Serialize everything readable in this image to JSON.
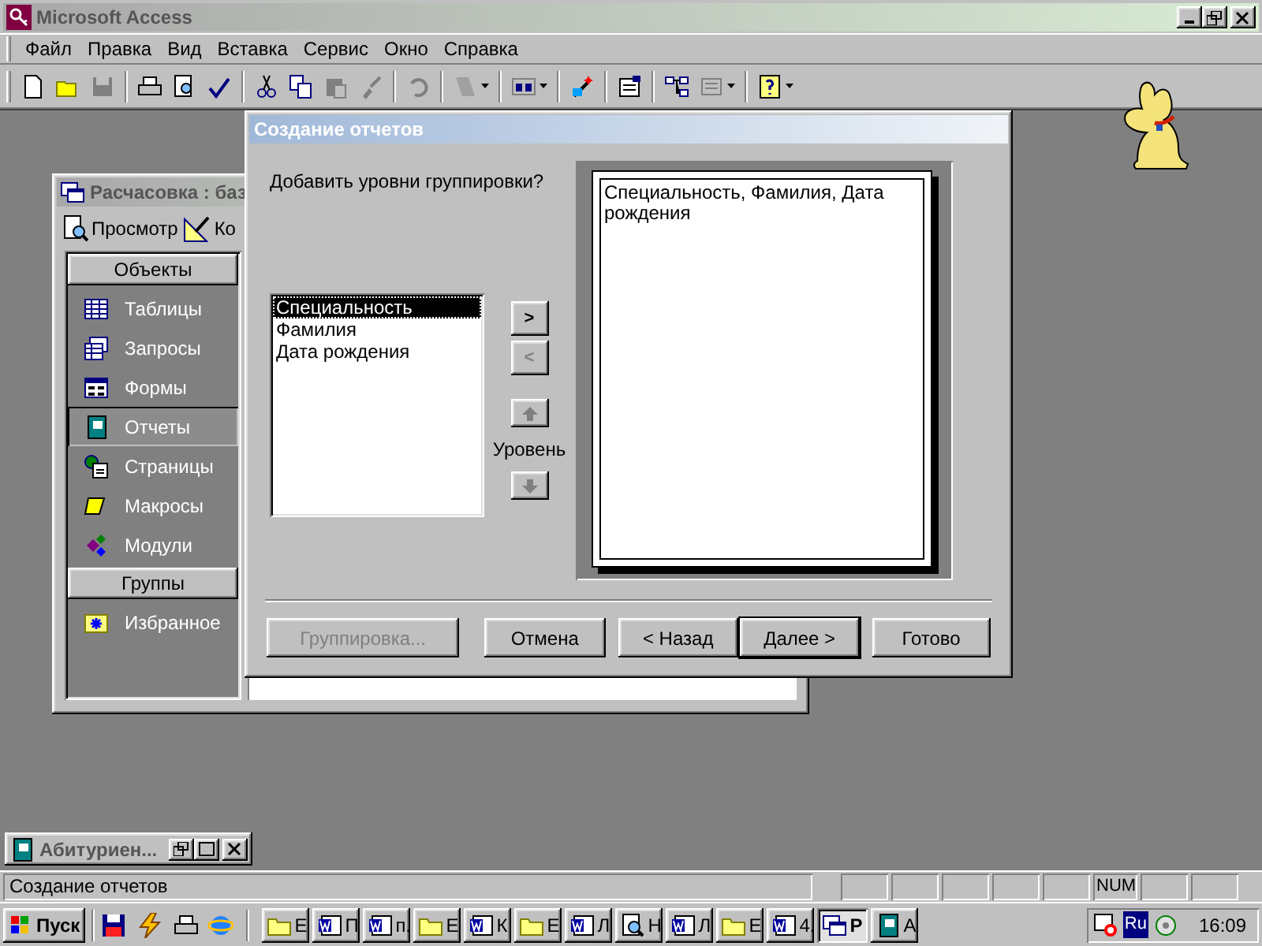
{
  "app_window": {
    "title": "Microsoft Access"
  },
  "menu": [
    {
      "label": "Файл"
    },
    {
      "label": "Правка"
    },
    {
      "label": "Вид"
    },
    {
      "label": "Вставка"
    },
    {
      "label": "Сервис"
    },
    {
      "label": "Окно"
    },
    {
      "label": "Справка"
    }
  ],
  "db_window": {
    "title": "Расчасовка : баз",
    "tools": [
      "Просмотр",
      "Ко"
    ],
    "sections": [
      {
        "header": "Объекты",
        "items": [
          {
            "label": "Таблицы",
            "kind": "table",
            "selected": false
          },
          {
            "label": "Запросы",
            "kind": "query",
            "selected": false
          },
          {
            "label": "Формы",
            "kind": "form",
            "selected": false
          },
          {
            "label": "Отчеты",
            "kind": "report",
            "selected": true
          },
          {
            "label": "Страницы",
            "kind": "page",
            "selected": false
          },
          {
            "label": "Макросы",
            "kind": "macro",
            "selected": false
          },
          {
            "label": "Модули",
            "kind": "module",
            "selected": false
          }
        ]
      },
      {
        "header": "Группы",
        "items": [
          {
            "label": "Избранное",
            "kind": "favorites",
            "selected": false
          }
        ]
      }
    ]
  },
  "wizard": {
    "title": "Создание отчетов",
    "prompt": "Добавить уровни группировки?",
    "fields": [
      {
        "label": "Специальность",
        "selected": true
      },
      {
        "label": "Фамилия",
        "selected": false
      },
      {
        "label": "Дата рождения",
        "selected": false
      }
    ],
    "move_buttons": [
      {
        "label": ">",
        "disabled": false
      },
      {
        "label": "<",
        "disabled": true
      }
    ],
    "level_label": "Уровень",
    "preview_text": "Специальность, Фамилия, Дата рождения",
    "buttons": [
      {
        "label": "Группировка...",
        "disabled": true,
        "default": false
      },
      {
        "label": "Отмена",
        "disabled": false,
        "default": false
      },
      {
        "label": "< Назад",
        "disabled": false,
        "default": false
      },
      {
        "label": "Далее >",
        "disabled": false,
        "default": true
      },
      {
        "label": "Готово",
        "disabled": false,
        "default": false
      }
    ]
  },
  "minimized_window": {
    "title": "Абитуриен..."
  },
  "status_bar": {
    "text": "Создание отчетов",
    "indicators": [
      {
        "label": "NUM"
      }
    ]
  },
  "taskbar": {
    "start": "Пуск",
    "buttons": [
      {
        "kind": "folder",
        "label": "Е",
        "selected": false
      },
      {
        "kind": "word",
        "label": "П",
        "selected": false
      },
      {
        "kind": "word",
        "label": "п.",
        "selected": false
      },
      {
        "kind": "folder",
        "label": "Е",
        "selected": false
      },
      {
        "kind": "word",
        "label": "К",
        "selected": false
      },
      {
        "kind": "folder",
        "label": "Е",
        "selected": false
      },
      {
        "kind": "word",
        "label": "Л",
        "selected": false
      },
      {
        "kind": "search",
        "label": "Н",
        "selected": false
      },
      {
        "kind": "word",
        "label": "Л",
        "selected": false
      },
      {
        "kind": "folder",
        "label": "Е",
        "selected": false
      },
      {
        "kind": "word",
        "label": "4.",
        "selected": false
      },
      {
        "kind": "windows",
        "label": "Р",
        "selected": true
      },
      {
        "kind": "book",
        "label": "А",
        "selected": false
      }
    ],
    "language": "Ru",
    "clock": "16:09"
  }
}
